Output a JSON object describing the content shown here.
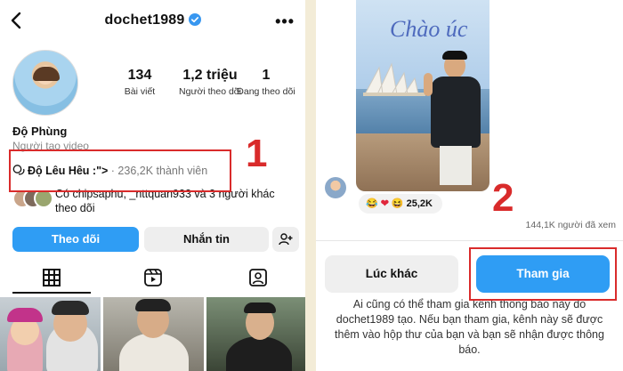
{
  "profile": {
    "username": "dochet1989",
    "more_label": "•••",
    "stats": [
      {
        "value": "134",
        "label": "Bài viết"
      },
      {
        "value": "1,2 triệu",
        "label": "Người theo dõi"
      },
      {
        "value": "1",
        "label": "Đang theo dõi"
      }
    ],
    "display_name": "Độ Phùng",
    "role": "Người tạo video",
    "channel_name": "Độ Lêu Hêu :\">",
    "channel_members": "· 236,2K thành viên",
    "followed_by": "Có chipsaphu, _nttquan933 và 3 người khác theo dõi",
    "follow_label": "Theo dõi",
    "message_label": "Nhắn tin"
  },
  "annotations": {
    "step1": "1",
    "step2": "2"
  },
  "channel_prompt": {
    "handwriting": "Chào úc",
    "reactions": "25,2K",
    "viewers": "144,1K người đã xem",
    "later_label": "Lúc khác",
    "join_label": "Tham gia",
    "description": "Ai cũng có thể tham gia kênh thông báo này do dochet1989 tạo. Nếu bạn tham gia, kênh này sẽ được thêm vào hộp thư của bạn và bạn sẽ nhận được thông báo."
  },
  "colors": {
    "accent": "#2f9df4",
    "annotation": "#d92b2b",
    "verified": "#3897f0"
  },
  "icons": [
    "back-arrow-icon",
    "verified-badge-icon",
    "more-icon",
    "channel-icon",
    "add-user-icon",
    "grid-icon",
    "reels-icon",
    "tagged-icon"
  ]
}
